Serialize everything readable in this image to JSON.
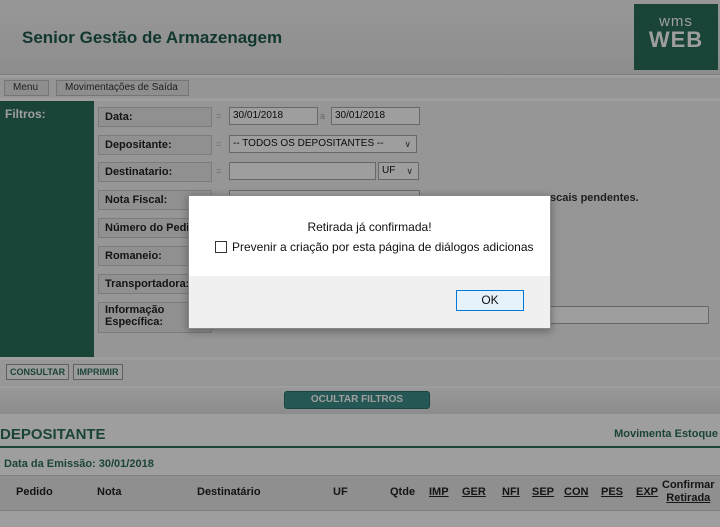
{
  "header": {
    "title": "Senior Gestão de Armazenagem",
    "logo_top": "wms",
    "logo_bottom": "WEB"
  },
  "breadcrumb": [
    "Menu",
    "Movimentações de Saída"
  ],
  "filters": {
    "label": "Filtros:",
    "fields": {
      "data": "Data:",
      "depositante": "Depositante:",
      "destinatario": "Destinatario:",
      "nota_fiscal": "Nota Fiscal:",
      "numero_pedido": "Número do Pedi",
      "romaneio": "Romaneio:",
      "transportadora": "Transportadora:",
      "informacao_1": "Informação",
      "informacao_2": "Específica:"
    },
    "date_from": "30/01/2018",
    "date_to": "30/01/2018",
    "depositante_selected": "-- TODOS OS DEPOSITANTES --",
    "uf_selected": "UF",
    "pending_label": "scais pendentes."
  },
  "actions": {
    "consultar": "CONSULTAR",
    "imprimir": "IMPRIMIR",
    "toggle_filters": "OCULTAR FILTROS"
  },
  "section": {
    "title": "DEPOSITANTE",
    "link": "Movimenta Estoque",
    "group_label": "Data da Emissão: 30/01/2018"
  },
  "table": {
    "columns": [
      "Pedido",
      "Nota",
      "Destinatário",
      "UF",
      "Qtde",
      "IMP",
      "GER",
      "NFI",
      "SEP",
      "CON",
      "PES",
      "EXP"
    ],
    "last_column_line1": "Confirmar",
    "last_column_line2": "Retirada"
  },
  "dialog": {
    "message": "Retirada já confirmada!",
    "checkbox_label": "Prevenir a criação por esta página de diálogos adicionas",
    "ok_label": "OK"
  },
  "colors": {
    "brand_green": "#2d6e5d",
    "teal_button": "#3d8f8a"
  }
}
